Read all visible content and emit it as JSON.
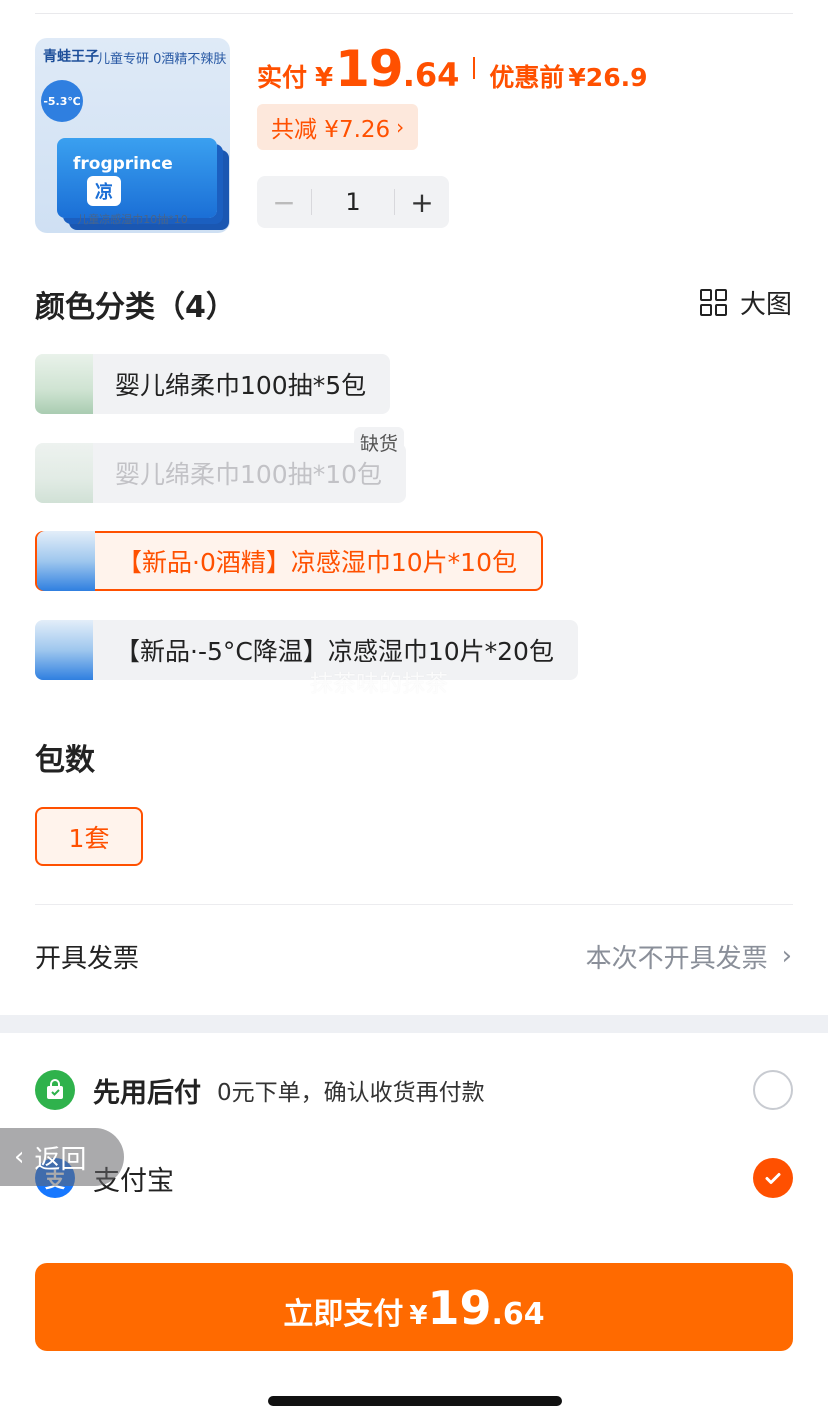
{
  "product": {
    "thumb": {
      "brand": "青蛙王子",
      "tagline": "儿童专研 0酒精不辣肤",
      "temp_badge": "-5.3℃",
      "pack_brand": "frogprince",
      "pack_mark": "凉",
      "caption": "儿童凉感湿巾10抽*10"
    },
    "price_label": "实付",
    "price_currency": "¥",
    "price_integer": "19",
    "price_decimal": ".64",
    "original_label": "优惠前",
    "original_price": "¥26.9",
    "discount_text": "共减 ¥7.26",
    "quantity": "1",
    "minus_label": "−",
    "plus_label": "+"
  },
  "color_section": {
    "title": "颜色分类（4）",
    "big_image_label": "大图",
    "options": [
      {
        "label": "婴儿绵柔巾100抽*5包",
        "state": "normal"
      },
      {
        "label": "婴儿绵柔巾100抽*10包",
        "state": "disabled",
        "tag": "缺货"
      },
      {
        "label": "【新品·0酒精】凉感湿巾10片*10包",
        "state": "selected"
      },
      {
        "label": "【新品·-5°C降温】凉感湿巾10片*20包",
        "state": "normal"
      }
    ],
    "watermark": "抹茶味的抹茶"
  },
  "pack_section": {
    "title": "包数",
    "options": [
      {
        "label": "1套",
        "state": "selected"
      }
    ]
  },
  "invoice": {
    "label": "开具发票",
    "value": "本次不开具发票"
  },
  "payments": [
    {
      "name": "先用后付",
      "desc": "0元下单，确认收货再付款",
      "icon": "shopping-bag-check-icon",
      "selected": false
    },
    {
      "name": "支付宝",
      "desc": "",
      "icon": "alipay-icon",
      "icon_glyph": "支",
      "selected": true
    }
  ],
  "back_button": {
    "label": "返回"
  },
  "pay_button": {
    "label": "立即支付",
    "currency": "¥",
    "integer": "19",
    "decimal": ".64"
  },
  "colors": {
    "accent": "#ff5000",
    "pay_button": "#ff6a00",
    "alipay_blue": "#1677ff",
    "green": "#2fb24c"
  }
}
